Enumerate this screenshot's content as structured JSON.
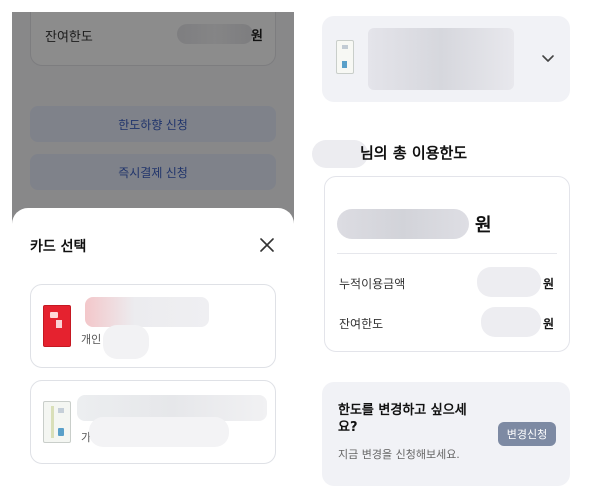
{
  "background_page": {
    "remaining_label": "잔여한도",
    "remaining_unit": "원",
    "limit_decrease_button": "한도하향 신청",
    "instant_payment_button": "즉시결제 신청"
  },
  "card_sheet": {
    "title": "카드 선택",
    "close_icon": "close-icon",
    "cards": [
      {
        "image": "red-card",
        "sub_text": "개인"
      },
      {
        "image": "white-card",
        "sub_text": "가"
      }
    ]
  },
  "limit_page": {
    "selector_chevron_icon": "chevron-down-icon",
    "total_limit_title": "님의 총 이용한도",
    "total_limit_unit": "원",
    "rows": [
      {
        "label": "누적이용금액",
        "unit": "원"
      },
      {
        "label": "잔여한도",
        "unit": "원"
      }
    ],
    "change_prompt": {
      "title": "한도를 변경하고 싶으세요?",
      "subtitle": "지금 변경을 신청해보세요.",
      "button": "변경신청"
    }
  },
  "colors": {
    "dim_overlay": "#000000",
    "button_blue_bg": "#e7edfb",
    "button_blue_text": "#3b5fc4",
    "change_button": "#7d8aa3",
    "panel_bg": "#f1f2f6"
  }
}
